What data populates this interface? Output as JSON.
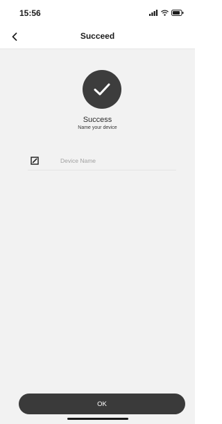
{
  "status_bar": {
    "time": "15:56",
    "icons": [
      "signal-icon",
      "wifi-icon",
      "battery-icon"
    ]
  },
  "nav": {
    "title": "Succeed",
    "back_icon": "chevron-left-icon"
  },
  "success": {
    "icon": "checkmark-icon",
    "title": "Success",
    "subtitle": "Name your device"
  },
  "device_name": {
    "icon": "edit-icon",
    "placeholder": "Device Name",
    "value": ""
  },
  "ok_button": {
    "label": "OK"
  },
  "colors": {
    "background": "#f2f2f2",
    "header": "#ffffff",
    "accent_dark": "#3a3a3a",
    "text_primary": "#1a1a1a",
    "placeholder": "#a0a0a0"
  }
}
